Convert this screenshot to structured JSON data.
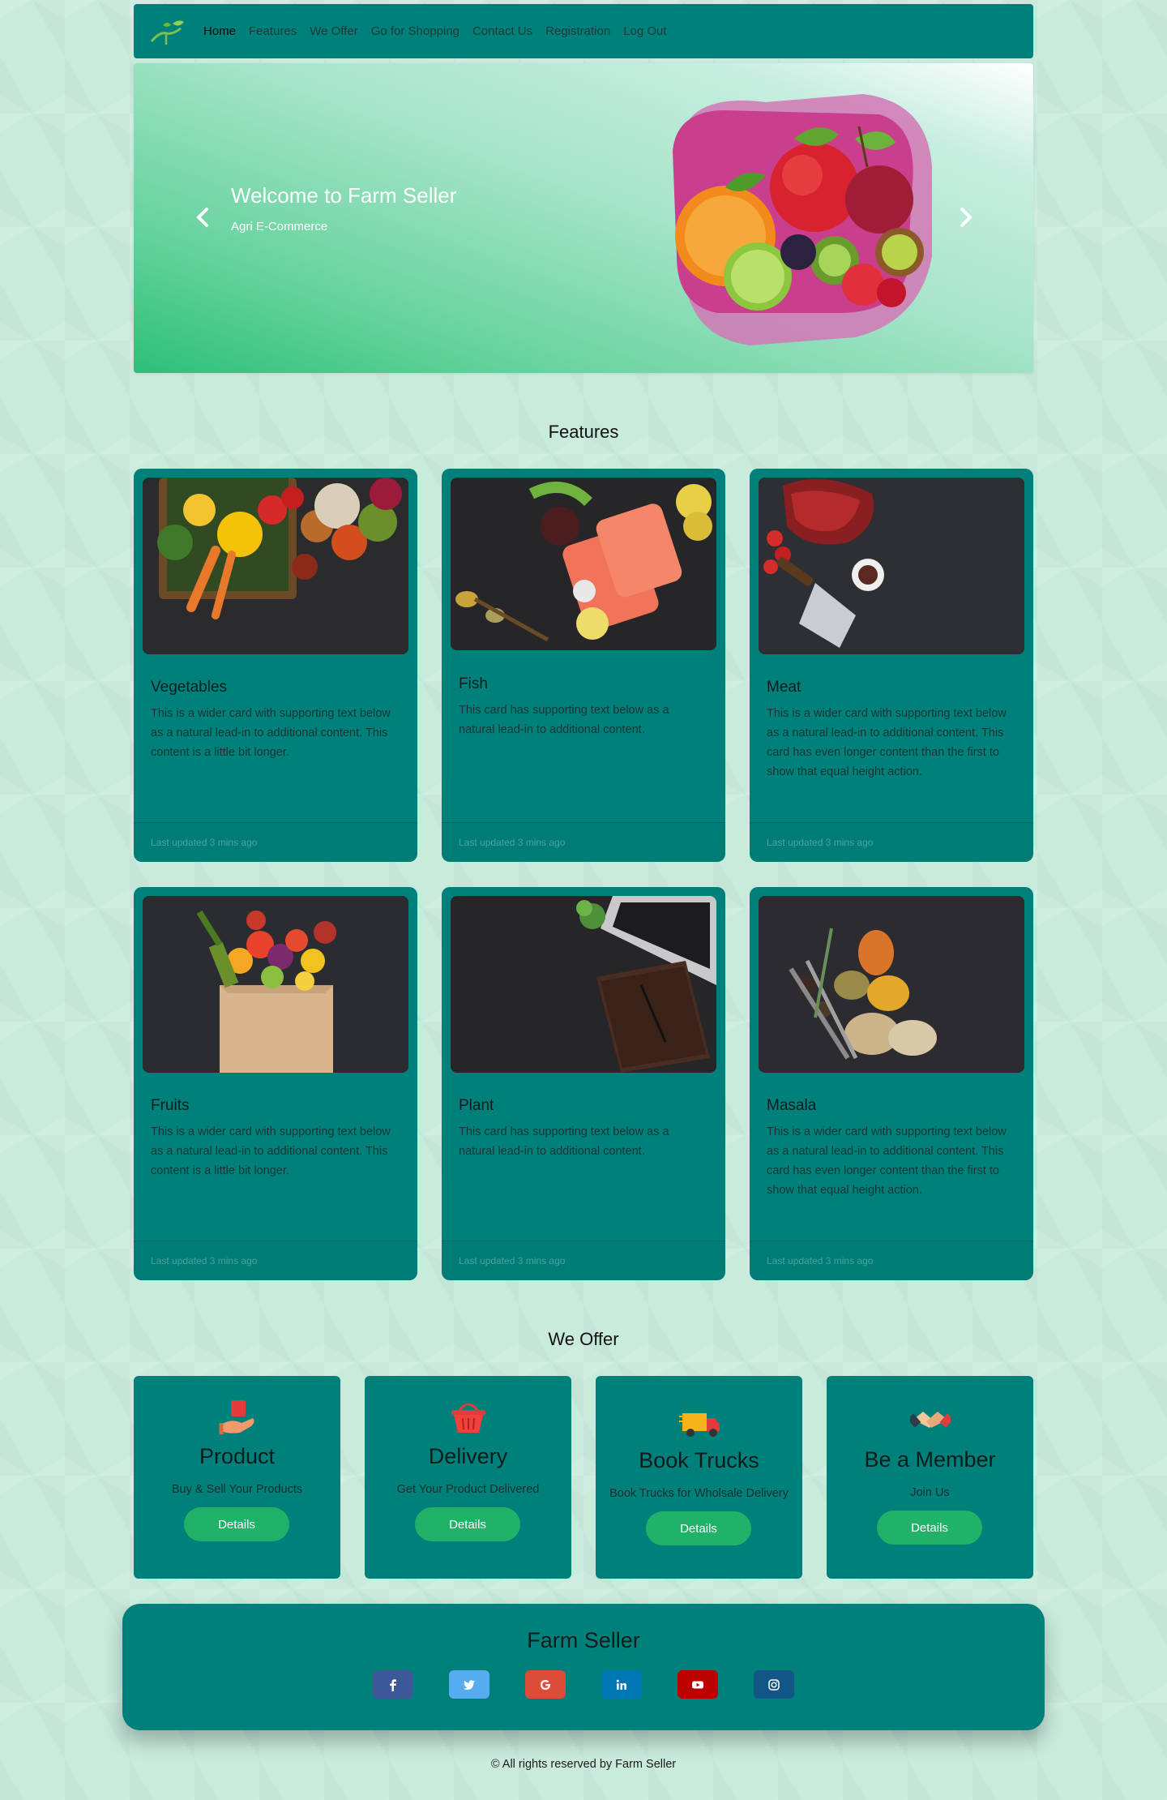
{
  "nav": {
    "items": [
      {
        "label": "Home",
        "active": true
      },
      {
        "label": "Features"
      },
      {
        "label": "We Offer"
      },
      {
        "label": "Go for Shopping"
      },
      {
        "label": "Contact Us"
      },
      {
        "label": "Registration"
      },
      {
        "label": "Log Out"
      }
    ]
  },
  "hero": {
    "title": "Welcome to Farm Seller",
    "subtitle": "Agri E-Commerce",
    "prev_icon": "chevron-left-icon",
    "next_icon": "chevron-right-icon"
  },
  "features": {
    "title": "Features",
    "cards": [
      {
        "title": "Vegetables",
        "text": "This is a wider card with supporting text below as a natural lead-in to additional content. This content is a little bit longer.",
        "footer": "Last updated 3 mins ago"
      },
      {
        "title": "Fish",
        "text": "This card has supporting text below as a natural lead-in to additional content.",
        "footer": "Last updated 3 mins ago"
      },
      {
        "title": "Meat",
        "text": "This is a wider card with supporting text below as a natural lead-in to additional content. This card has even longer content than the first to show that equal height action.",
        "footer": "Last updated 3 mins ago"
      },
      {
        "title": "Fruits",
        "text": "This is a wider card with supporting text below as a natural lead-in to additional content. This content is a little bit longer.",
        "footer": "Last updated 3 mins ago"
      },
      {
        "title": "Plant",
        "text": "This card has supporting text below as a natural lead-in to additional content.",
        "footer": "Last updated 3 mins ago"
      },
      {
        "title": "Masala",
        "text": "This is a wider card with supporting text below as a natural lead-in to additional content. This card has even longer content than the first to show that equal height action.",
        "footer": "Last updated 3 mins ago"
      }
    ]
  },
  "offer": {
    "title": "We Offer",
    "items": [
      {
        "icon": "hand-box-icon",
        "title": "Product",
        "subtitle": "Buy & Sell Your Products",
        "button": "Details"
      },
      {
        "icon": "basket-icon",
        "title": "Delivery",
        "subtitle": "Get Your Product Delivered",
        "button": "Details"
      },
      {
        "icon": "truck-icon",
        "title": "Book Trucks",
        "subtitle": "Book Trucks for Wholsale Delivery",
        "button": "Details"
      },
      {
        "icon": "handshake-icon",
        "title": "Be a Member",
        "subtitle": "Join Us",
        "button": "Details"
      }
    ]
  },
  "footer": {
    "title": "Farm Seller",
    "social": [
      {
        "name": "facebook-icon",
        "color": "#3b5998"
      },
      {
        "name": "twitter-icon",
        "color": "#55acee"
      },
      {
        "name": "google-icon",
        "color": "#dd4b39"
      },
      {
        "name": "linkedin-icon",
        "color": "#0077b5"
      },
      {
        "name": "youtube-icon",
        "color": "#bb0000"
      },
      {
        "name": "instagram-icon",
        "color": "#125688"
      }
    ],
    "copyright": "© All rights reserved by Farm Seller"
  },
  "colors": {
    "teal": "#00807a",
    "button_green": "#21b26a",
    "background": "#c9ebdc"
  }
}
